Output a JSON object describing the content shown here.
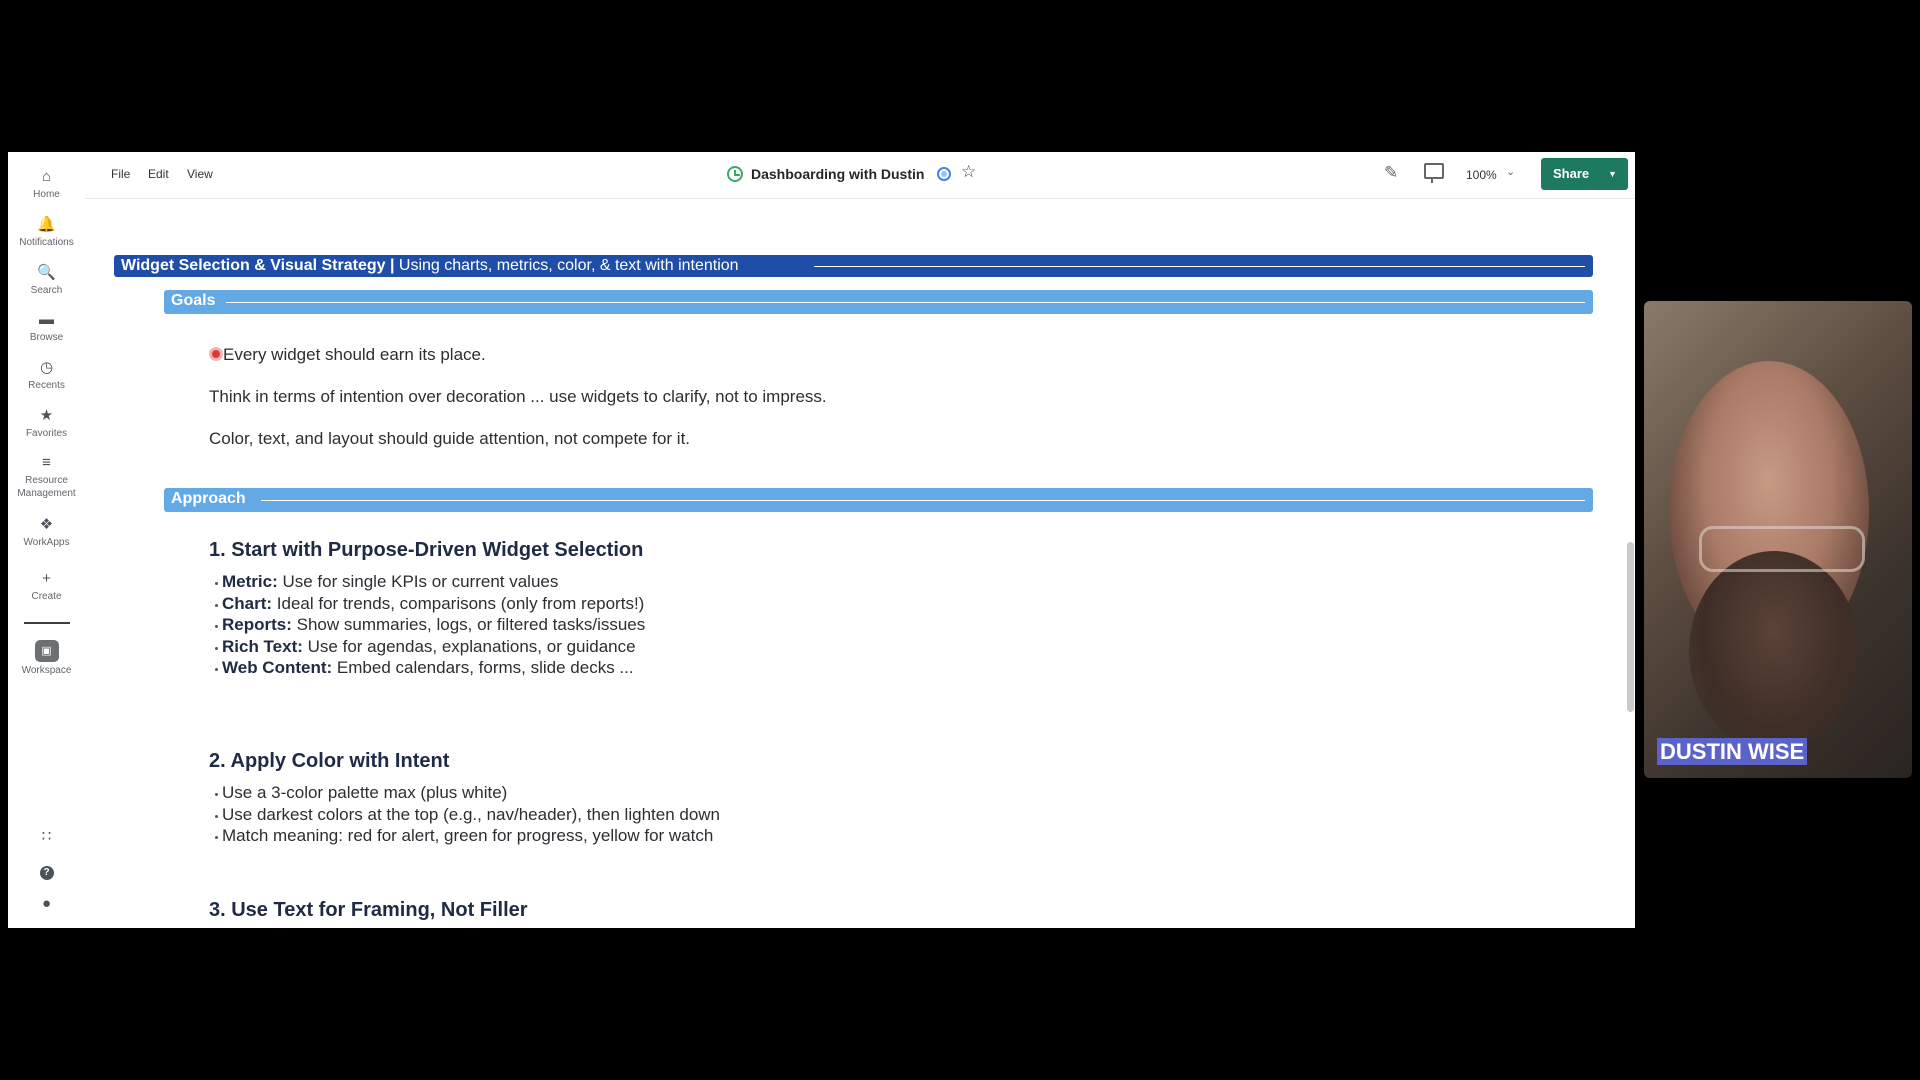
{
  "sidebar": {
    "items": [
      {
        "label": "Home",
        "icon": "home-icon"
      },
      {
        "label": "Notifications",
        "icon": "bell-icon"
      },
      {
        "label": "Search",
        "icon": "search-icon"
      },
      {
        "label": "Browse",
        "icon": "folder-icon"
      },
      {
        "label": "Recents",
        "icon": "clock-icon"
      },
      {
        "label": "Favorites",
        "icon": "star-icon"
      },
      {
        "label": "Resource",
        "label2": "Management",
        "icon": "people-icon"
      },
      {
        "label": "WorkApps",
        "icon": "workapps-icon"
      },
      {
        "label": "Create",
        "icon": "plus-icon"
      },
      {
        "label": "Workspace",
        "icon": "workspace-icon"
      }
    ]
  },
  "topbar": {
    "menu": [
      "File",
      "Edit",
      "View"
    ],
    "title": "Dashboarding with Dustin",
    "zoom": "100%",
    "share_label": "Share"
  },
  "content": {
    "banner_title": "Widget Selection & Visual Strategy |",
    "banner_subtitle": "Using charts, metrics, color, & text with intention",
    "goals_label": "Goals",
    "goals": [
      "Every widget should earn its place.",
      "Think in terms of intention over decoration ... use widgets to clarify, not to impress.",
      "Color, text, and layout should guide attention, not compete for it."
    ],
    "approach_label": "Approach",
    "section1_title": "1. Start with Purpose-Driven Widget Selection",
    "section1_items": [
      {
        "term": "Metric:",
        "desc": "Use for single KPIs or current values"
      },
      {
        "term": "Chart:",
        "desc": "Ideal for trends, comparisons (only from reports!)"
      },
      {
        "term": "Reports:",
        "desc": "Show summaries, logs, or filtered tasks/issues"
      },
      {
        "term": "Rich Text:",
        "desc": "Use for agendas, explanations, or guidance"
      },
      {
        "term": "Web Content:",
        "desc": "Embed calendars, forms, slide decks ..."
      }
    ],
    "section2_title": "2. Apply Color with Intent",
    "section2_items": [
      "Use a 3-color palette max (plus white)",
      "Use darkest colors at the top (e.g., nav/header), then lighten down",
      "Match meaning: red for alert, green for progress, yellow for watch"
    ],
    "section3_title": "3. Use Text for Framing, Not Filler"
  },
  "webcam": {
    "name": "DUSTIN WISE"
  }
}
